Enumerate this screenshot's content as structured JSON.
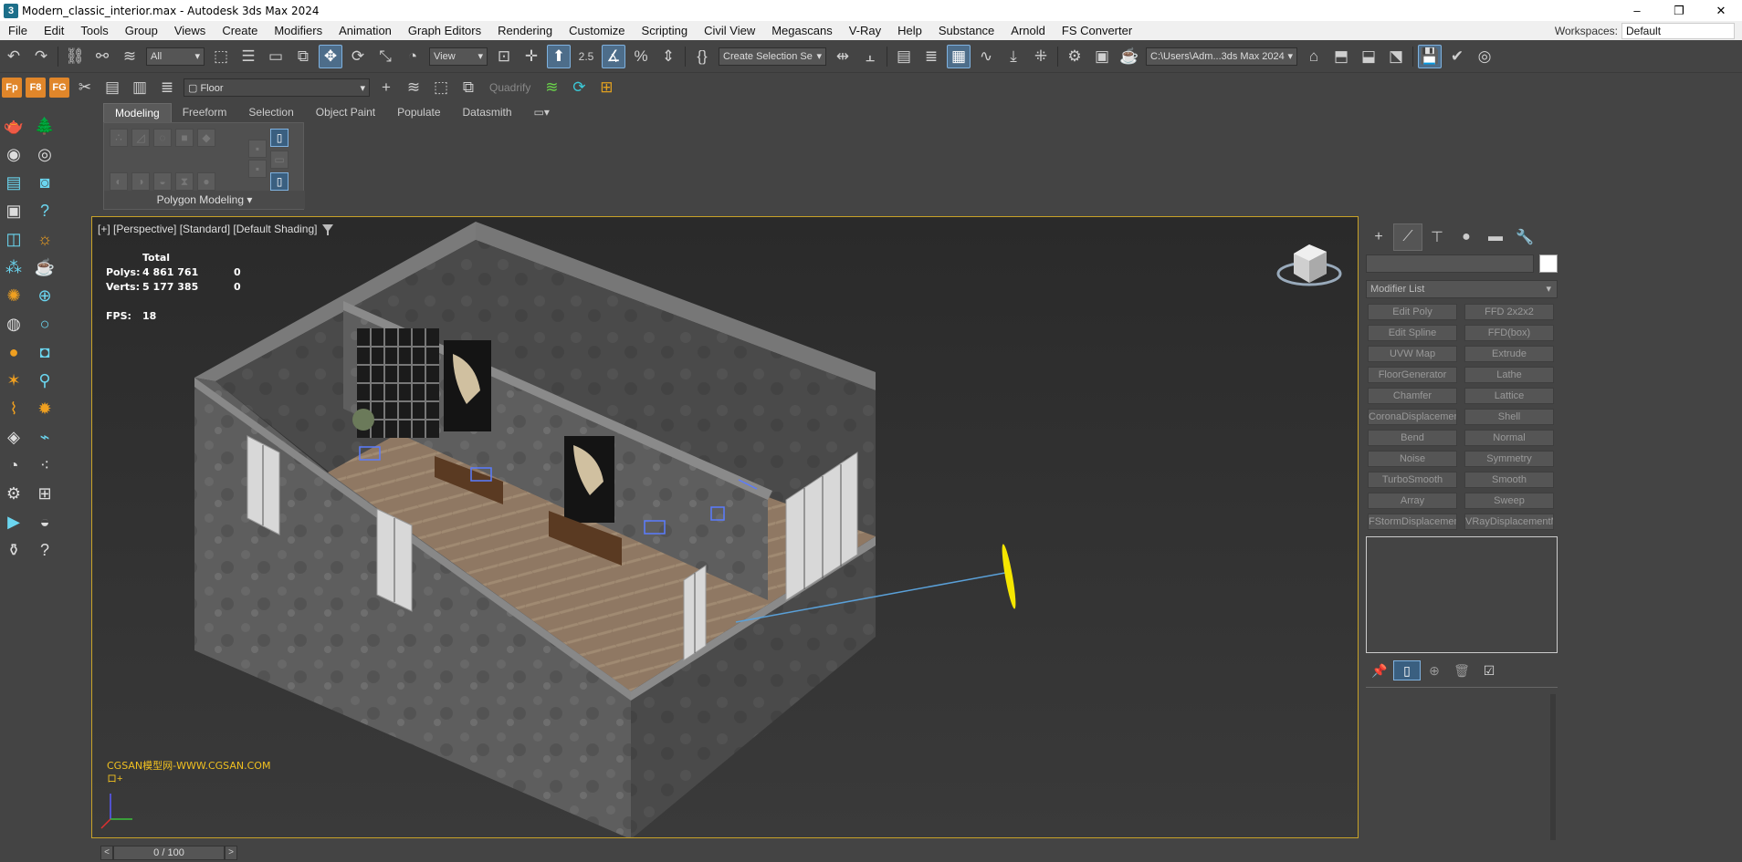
{
  "window": {
    "title": "Modern_classic_interior.max - Autodesk 3ds Max 2024",
    "minimize": "–",
    "restore": "❐",
    "close": "✕"
  },
  "menu": {
    "items": [
      "File",
      "Edit",
      "Tools",
      "Group",
      "Views",
      "Create",
      "Modifiers",
      "Animation",
      "Graph Editors",
      "Rendering",
      "Customize",
      "Scripting",
      "Civil View",
      "Megascans",
      "V-Ray",
      "Help",
      "Substance",
      "Arnold",
      "FS Converter"
    ],
    "workspaces_label": "Workspaces:",
    "workspaces_value": "Default"
  },
  "toolbar": {
    "filter_value": "All",
    "ref_coord": "View",
    "selection_set": "Create Selection Se",
    "project_path": "C:\\Users\\Adm...3ds Max 2024",
    "snap_label": "2.5"
  },
  "toolbar2": {
    "layer_value": "Floor",
    "quadrify": "Quadrify",
    "fp_labels": [
      "Fp",
      "F8",
      "FG"
    ]
  },
  "ribbon": {
    "tabs": [
      "Modeling",
      "Freeform",
      "Selection",
      "Object Paint",
      "Populate",
      "Datasmith"
    ],
    "panel_label": "Polygon Modeling"
  },
  "viewport": {
    "label": "[+] [Perspective] [Standard] [Default Shading]",
    "stats": {
      "header": "Total",
      "polys_label": "Polys:",
      "polys_value": "4 861 761",
      "polys_sel": "0",
      "verts_label": "Verts:",
      "verts_value": "5 177 385",
      "verts_sel": "0",
      "fps_label": "FPS:",
      "fps_value": "18"
    },
    "watermark": "CGSAN模型网-WWW.CGSAN.COM",
    "watermark2": "ロ+"
  },
  "command_panel": {
    "modifier_list": "Modifier List",
    "modifiers": [
      [
        "Edit Poly",
        "FFD 2x2x2"
      ],
      [
        "Edit Spline",
        "FFD(box)"
      ],
      [
        "UVW Map",
        "Extrude"
      ],
      [
        "FloorGenerator",
        "Lathe"
      ],
      [
        "Chamfer",
        "Lattice"
      ],
      [
        "CoronaDisplacement",
        "Shell"
      ],
      [
        "Bend",
        "Normal"
      ],
      [
        "Noise",
        "Symmetry"
      ],
      [
        "TurboSmooth",
        "Smooth"
      ],
      [
        "Array",
        "Sweep"
      ],
      [
        "FStormDisplacement",
        "VRayDisplacementMod"
      ]
    ]
  },
  "timeline": {
    "value": "0 / 100",
    "prev": "<",
    "next": ">"
  }
}
